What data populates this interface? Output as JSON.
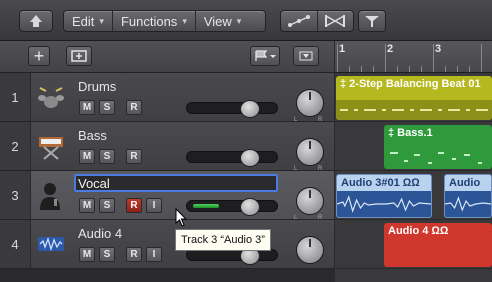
{
  "toolbar": {
    "menus": [
      {
        "label": "Edit"
      },
      {
        "label": "Functions"
      },
      {
        "label": "View"
      }
    ]
  },
  "tracks": [
    {
      "number": "1",
      "name": "Drums",
      "icon": "drum-kit-icon",
      "m": "M",
      "s": "S",
      "r": "R",
      "i": ""
    },
    {
      "number": "2",
      "name": "Bass",
      "icon": "keyboard-synth-icon",
      "m": "M",
      "s": "S",
      "r": "R",
      "i": ""
    },
    {
      "number": "3",
      "name": "Vocal",
      "icon": "singer-icon",
      "m": "M",
      "s": "S",
      "r": "R",
      "i": "I"
    },
    {
      "number": "4",
      "name": "Audio 4",
      "icon": "waveform-icon",
      "m": "M",
      "s": "S",
      "r": "R",
      "i": "I"
    }
  ],
  "ruler": {
    "bars": [
      "1",
      "2",
      "3"
    ]
  },
  "regions": [
    {
      "name": "‡ 2-Step Balancing Beat 01",
      "color": "#b5b81f"
    },
    {
      "name": "‡ Bass.1",
      "color": "#2f9a3c"
    },
    {
      "name": "Audio 3#01 ΩΩ",
      "color": "#b9d2ee"
    },
    {
      "name": "Audio",
      "color": "#b9d2ee"
    },
    {
      "name": "Audio 4 ΩΩ",
      "color": "#d0382e"
    }
  ],
  "tooltip": {
    "text": "Track 3 “Audio 3”"
  },
  "colors": {
    "selection": "#4a7be0",
    "record": "#c43a2e"
  }
}
